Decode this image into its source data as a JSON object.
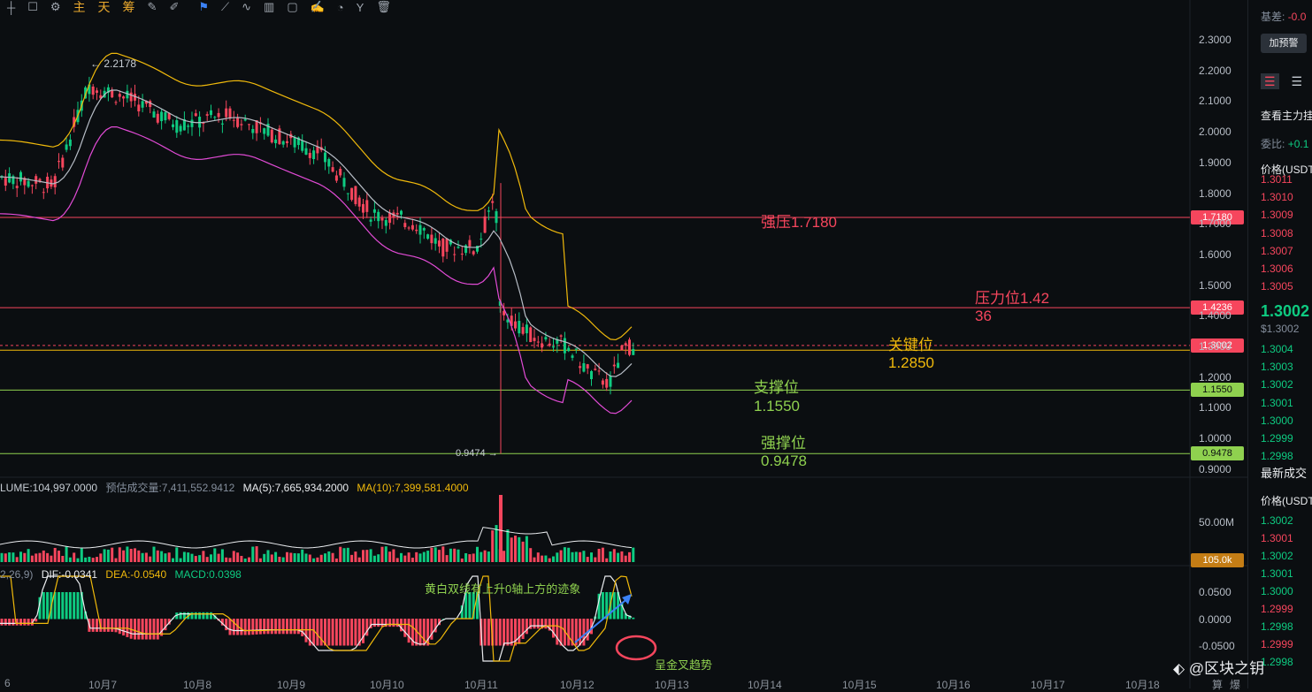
{
  "toolbar": {
    "icons": [
      "crosshair-icon",
      "square-icon",
      "indicator-icon"
    ],
    "labels": [
      "主",
      "天",
      "筹"
    ],
    "tool_icons": [
      "pen-icon",
      "brush-icon",
      "pin-icon",
      "ruler-icon",
      "measure-icon",
      "candles-icon",
      "note-icon",
      "edit-icon",
      "magnet-icon",
      "fork-icon",
      "trash-icon"
    ]
  },
  "price_axis": {
    "ticks": [
      "2.3000",
      "2.2000",
      "2.1000",
      "2.0000",
      "1.9000",
      "1.8000",
      "1.7000",
      "1.6000",
      "1.5000",
      "1.4000",
      "1.3000",
      "1.2000",
      "1.1000",
      "1.0000",
      "0.9000"
    ],
    "volume_ticks": [
      "50.00M"
    ],
    "macd_ticks": [
      "0.0500",
      "0.0000",
      "-0.0500"
    ]
  },
  "price_markers": {
    "strong_resistance": "1.7180",
    "resistance": "1.4236",
    "current": "1.3002",
    "support": "1.1550",
    "strong_support": "0.9478",
    "volume_current": "105.0k"
  },
  "annotations": {
    "high": "← 2.2178",
    "low": "0.9474 →",
    "strong_resistance": "强压1.7180",
    "resistance_line1": "压力位1.42",
    "resistance_line2": "36",
    "key_line1": "关键位",
    "key_line2": "1.2850",
    "support_line1": "支撑位",
    "support_line2": "1.1550",
    "strong_support_line1": "强撑位",
    "strong_support_line2": "0.9478",
    "macd_note": "黄白双线有上升0轴上方的迹象",
    "golden_cross": "呈金叉趋势"
  },
  "volume_info": {
    "volume": "LUME:104,997.0000",
    "estimated": "预估成交量:7,411,552.9412",
    "ma5": "MA(5):7,665,934.2000",
    "ma10": "MA(10):7,399,581.4000"
  },
  "macd_info": {
    "params": "2,26,9)",
    "dif": "DIF:-0.0341",
    "dea": "DEA:-0.0540",
    "macd": "MACD:0.0398"
  },
  "x_axis": {
    "ticks": [
      "6",
      "10月7",
      "10月8",
      "10月9",
      "10月10",
      "10月11",
      "10月12",
      "10月13",
      "10月14",
      "10月15",
      "10月16",
      "10月17",
      "10月18"
    ]
  },
  "x_axis_extra": [
    "算",
    "爆"
  ],
  "panel": {
    "basis_label": "基差:",
    "basis_value": "-0.0",
    "add_alert": "加预警",
    "view_orders": "查看主力挂",
    "ratio_label": "委比:",
    "ratio_value": "+0.1",
    "price_header": "价格(USDT",
    "asks": [
      "1.3011",
      "1.3010",
      "1.3009",
      "1.3008",
      "1.3007",
      "1.3006",
      "1.3005"
    ],
    "last_price": "1.3002",
    "last_price_usd": "$1.3002",
    "bids": [
      "1.3004",
      "1.3003",
      "1.3002",
      "1.3001",
      "1.3000",
      "1.2999",
      "1.2998"
    ],
    "latest_trades": "最新成交",
    "trades_header": "价格(USDT",
    "trades": [
      {
        "p": "1.3002",
        "c": "green"
      },
      {
        "p": "1.3001",
        "c": "red"
      },
      {
        "p": "1.3002",
        "c": "green"
      },
      {
        "p": "1.3001",
        "c": "green"
      },
      {
        "p": "1.3000",
        "c": "green"
      },
      {
        "p": "1.2999",
        "c": "red"
      },
      {
        "p": "1.2998",
        "c": "green"
      },
      {
        "p": "1.2999",
        "c": "red"
      },
      {
        "p": "1.2998",
        "c": "green"
      }
    ]
  },
  "watermark": "@区块之钥",
  "colors": {
    "up": "#0ecb81",
    "down": "#f6465d",
    "yellow": "#f0b90b",
    "support": "#8fd14f",
    "resistance": "#f6465d"
  }
}
